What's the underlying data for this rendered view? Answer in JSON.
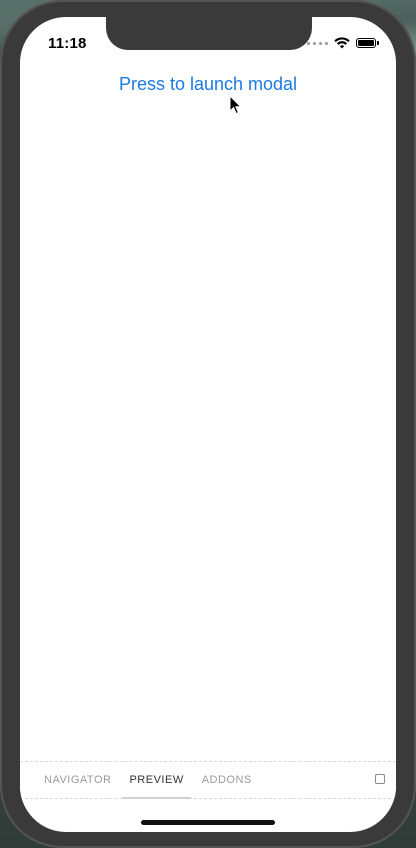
{
  "status_bar": {
    "time": "11:18"
  },
  "main": {
    "launch_link": "Press to launch modal"
  },
  "addon_panel": {
    "tabs": [
      {
        "label": "NAVIGATOR",
        "active": false
      },
      {
        "label": "PREVIEW",
        "active": true
      },
      {
        "label": "ADDONS",
        "active": false
      }
    ]
  },
  "colors": {
    "link": "#1b7ae4",
    "device_frame": "#3a3a3a"
  }
}
